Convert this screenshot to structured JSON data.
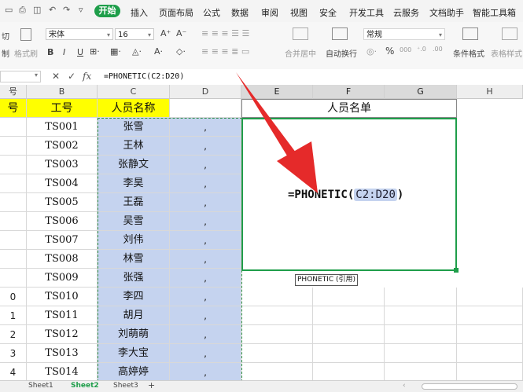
{
  "menubar": {
    "tabs": [
      {
        "label": "开始",
        "active": true
      },
      {
        "label": "插入"
      },
      {
        "label": "页面布局"
      },
      {
        "label": "公式"
      },
      {
        "label": "数据"
      },
      {
        "label": "审阅"
      },
      {
        "label": "视图"
      },
      {
        "label": "安全"
      },
      {
        "label": "开发工具"
      },
      {
        "label": "云服务"
      },
      {
        "label": "文档助手"
      },
      {
        "label": "智能工具箱"
      }
    ]
  },
  "ribbon": {
    "cut": "切",
    "paste_label": "制",
    "format_painter": "格式刷",
    "font_name": "宋体",
    "font_size": "16",
    "bold": "B",
    "italic": "I",
    "underline": "U",
    "merge_center": "合并居中",
    "wrap_text": "自动换行",
    "number_format": "常规",
    "percent": "%",
    "thousands": "000",
    "cond_format": "条件格式",
    "table_style": "表格样式"
  },
  "formula_bar": {
    "fx": "fx",
    "formula": "=PHONETIC(C2:D20)"
  },
  "columns": [
    "号",
    "B",
    "C",
    "D",
    "E",
    "F",
    "G",
    "H"
  ],
  "headers": {
    "a": "号",
    "b": "工号",
    "c": "人员名称",
    "merged": "人员名单"
  },
  "rows": [
    {
      "a": "",
      "id": "TS001",
      "name": "张雪",
      "sep": ","
    },
    {
      "a": "",
      "id": "TS002",
      "name": "王林",
      "sep": ","
    },
    {
      "a": "",
      "id": "TS003",
      "name": "张静文",
      "sep": ","
    },
    {
      "a": "",
      "id": "TS004",
      "name": "李昊",
      "sep": ","
    },
    {
      "a": "",
      "id": "TS005",
      "name": "王磊",
      "sep": ","
    },
    {
      "a": "",
      "id": "TS006",
      "name": "吴雪",
      "sep": ","
    },
    {
      "a": "",
      "id": "TS007",
      "name": "刘伟",
      "sep": ","
    },
    {
      "a": "",
      "id": "TS008",
      "name": "林雪",
      "sep": ","
    },
    {
      "a": "",
      "id": "TS009",
      "name": "张强",
      "sep": ","
    },
    {
      "a": "0",
      "id": "TS010",
      "name": "李四",
      "sep": ","
    },
    {
      "a": "1",
      "id": "TS011",
      "name": "胡月",
      "sep": ","
    },
    {
      "a": "2",
      "id": "TS012",
      "name": "刘萌萌",
      "sep": ","
    },
    {
      "a": "3",
      "id": "TS013",
      "name": "李大宝",
      "sep": ","
    },
    {
      "a": "4",
      "id": "TS014",
      "name": "高婷婷",
      "sep": ","
    }
  ],
  "edit": {
    "prefix": "=PHONETIC(",
    "ref": "C2:D20",
    "suffix": ")"
  },
  "tooltip": "PHONETIC (引用)",
  "sheets": [
    {
      "label": "Sheet1"
    },
    {
      "label": "Sheet2",
      "active": true
    },
    {
      "label": "Sheet3"
    }
  ],
  "add_sheet": "+",
  "colors": {
    "accent": "#1e9e4a",
    "header_yellow": "#ffff00",
    "selection_blue": "#c5d3ef",
    "arrow_red": "#e52a2a"
  }
}
